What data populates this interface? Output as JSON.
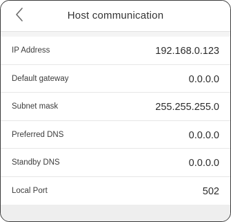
{
  "header": {
    "title": "Host communication",
    "back_icon": "chevron-left-icon"
  },
  "settings": [
    {
      "label": "IP Address",
      "value": "192.168.0.123"
    },
    {
      "label": "Default gateway",
      "value": "0.0.0.0"
    },
    {
      "label": "Subnet mask",
      "value": "255.255.255.0"
    },
    {
      "label": "Preferred DNS",
      "value": "0.0.0.0"
    },
    {
      "label": "Standby DNS",
      "value": "0.0.0.0"
    },
    {
      "label": "Local Port",
      "value": "502"
    }
  ],
  "colors": {
    "background": "#f4f4f4",
    "row_background": "#ffffff",
    "text": "#333333",
    "divider": "#e6e6e6"
  }
}
